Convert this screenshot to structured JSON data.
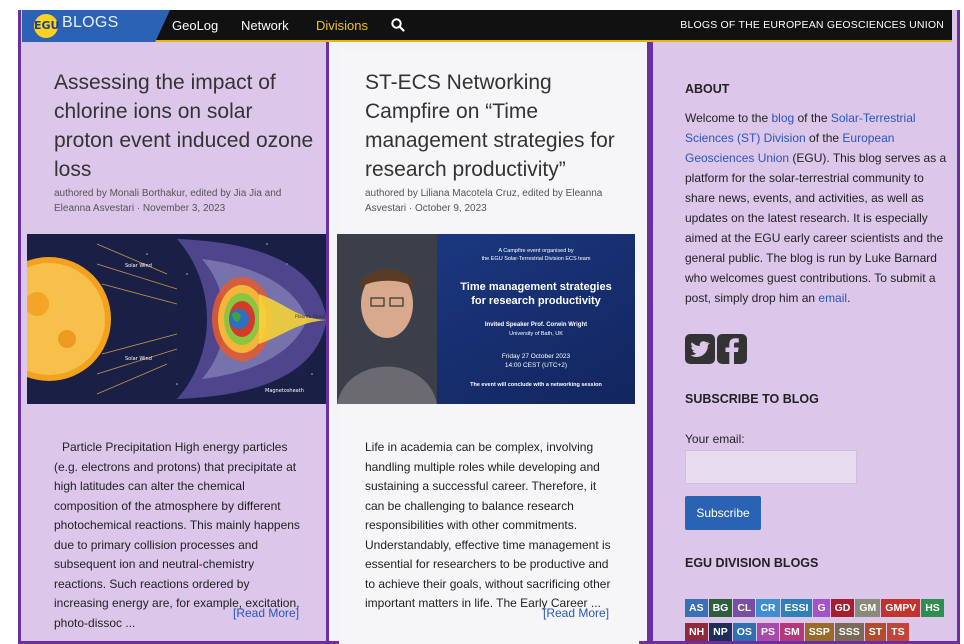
{
  "nav": {
    "logo_badge": "EGU",
    "logo_text": "BLOGS",
    "items": [
      {
        "label": "GeoLog"
      },
      {
        "label": "Network"
      },
      {
        "label": "Divisions"
      }
    ],
    "right_text": "BLOGS OF THE EUROPEAN GEOSCIENCES UNION"
  },
  "posts": [
    {
      "title": "Assessing the impact of chlorine ions on solar proton event induced ozone loss",
      "byline": "authored by Monali Borthakur, edited by Jia Jia and Eleanna Asvestari · November 3, 2023",
      "image_labels": {
        "solar_wind_top": "Solar Wind",
        "solar_wind_bottom": "Solar Wind",
        "magnetosheath": "Magnetosheath",
        "plasma_sheet": "Plasma Sheet"
      },
      "excerpt": "Particle Precipitation High energy particles (e.g. electrons and protons) that precipitate at high latitudes can alter the chemical composition of the atmosphere by different photochemical reactions. This mainly happens due to primary collision processes and subsequent ion and neutral-chemistry reactions. Such reactions ordered by increasing energy are, for example, excitation, photo-dissoc ...",
      "read_more": "[Read More]"
    },
    {
      "title": "ST-ECS Networking Campfire on “Time management strategies for research productivity”",
      "byline": "authored by Liliana Macotela Cruz, edited by Eleanna Asvestari · October 9, 2023",
      "image_text": {
        "organised": "A Campfire event organised by",
        "team": "the EGU Solar-Terrestrial Division ECS team",
        "headline1": "Time management strategies",
        "headline2": "for research productivity",
        "speaker": "Invited Speaker Prof. Corwin Wright",
        "university": "University of Bath, UK",
        "date": "Friday 27 October 2023",
        "time": "14:00 CEST (UTC+2)",
        "closing": "The event will conclude with a networking session"
      },
      "excerpt": "Life in academia can be complex, involving handling multiple roles while developing and sustaining a successful career. Therefore, it can be challenging to balance research responsibilities with other commitments. Understandably, effective time management is essential for researchers to be productive and to achieve their goals, without sacrificing other important matters in life. The Early Career ...",
      "read_more": "[Read More]"
    }
  ],
  "sidebar": {
    "about_title": "ABOUT",
    "about": {
      "p1": "Welcome to the ",
      "link_blog": "blog",
      "p2": " of the ",
      "link_st": "Solar-Terrestrial Sciences (ST) Division",
      "p3": " of the ",
      "link_egu": "European Geosciences Union",
      "p4": " (EGU). This blog serves as a platform for the solar-terrestrial community to share news, events, and activities, as well as updates on the latest research. It is especially aimed at the EGU early career scientists and the general public. The blog is run by Luke Barnard who welcomes guest contributions. To submit a post, simply drop him an ",
      "link_email": "email",
      "p5": "."
    },
    "subscribe_title": "SUBSCRIBE TO BLOG",
    "email_label": "Your email:",
    "subscribe_button": "Subscribe",
    "divisions_title": "EGU DIVISION BLOGS",
    "divisions": [
      {
        "code": "AS",
        "color": "#3b6fb6"
      },
      {
        "code": "BG",
        "color": "#2e5f3b"
      },
      {
        "code": "CL",
        "color": "#7a4fa1"
      },
      {
        "code": "CR",
        "color": "#3f8fd0"
      },
      {
        "code": "ESSI",
        "color": "#2f7fb8"
      },
      {
        "code": "G",
        "color": "#a552c8"
      },
      {
        "code": "GD",
        "color": "#a51f2f"
      },
      {
        "code": "GM",
        "color": "#8a8a7a"
      },
      {
        "code": "GMPV",
        "color": "#c2332c"
      },
      {
        "code": "HS",
        "color": "#2f8f4e"
      },
      {
        "code": "NH",
        "color": "#8e2a3a"
      },
      {
        "code": "NP",
        "color": "#1f2d58"
      },
      {
        "code": "OS",
        "color": "#2f6fb0"
      },
      {
        "code": "PS",
        "color": "#a84aa9"
      },
      {
        "code": "SM",
        "color": "#b23a7a"
      },
      {
        "code": "SSP",
        "color": "#9a6a2a"
      },
      {
        "code": "SSS",
        "color": "#7b6a58"
      },
      {
        "code": "ST",
        "color": "#b04d2d"
      },
      {
        "code": "TS",
        "color": "#c0463a"
      }
    ]
  },
  "colors": {
    "frame": "#6a2fa0",
    "lavender": "#dcc7ea",
    "link": "#2a56b8",
    "nav_active": "#f0c419"
  }
}
